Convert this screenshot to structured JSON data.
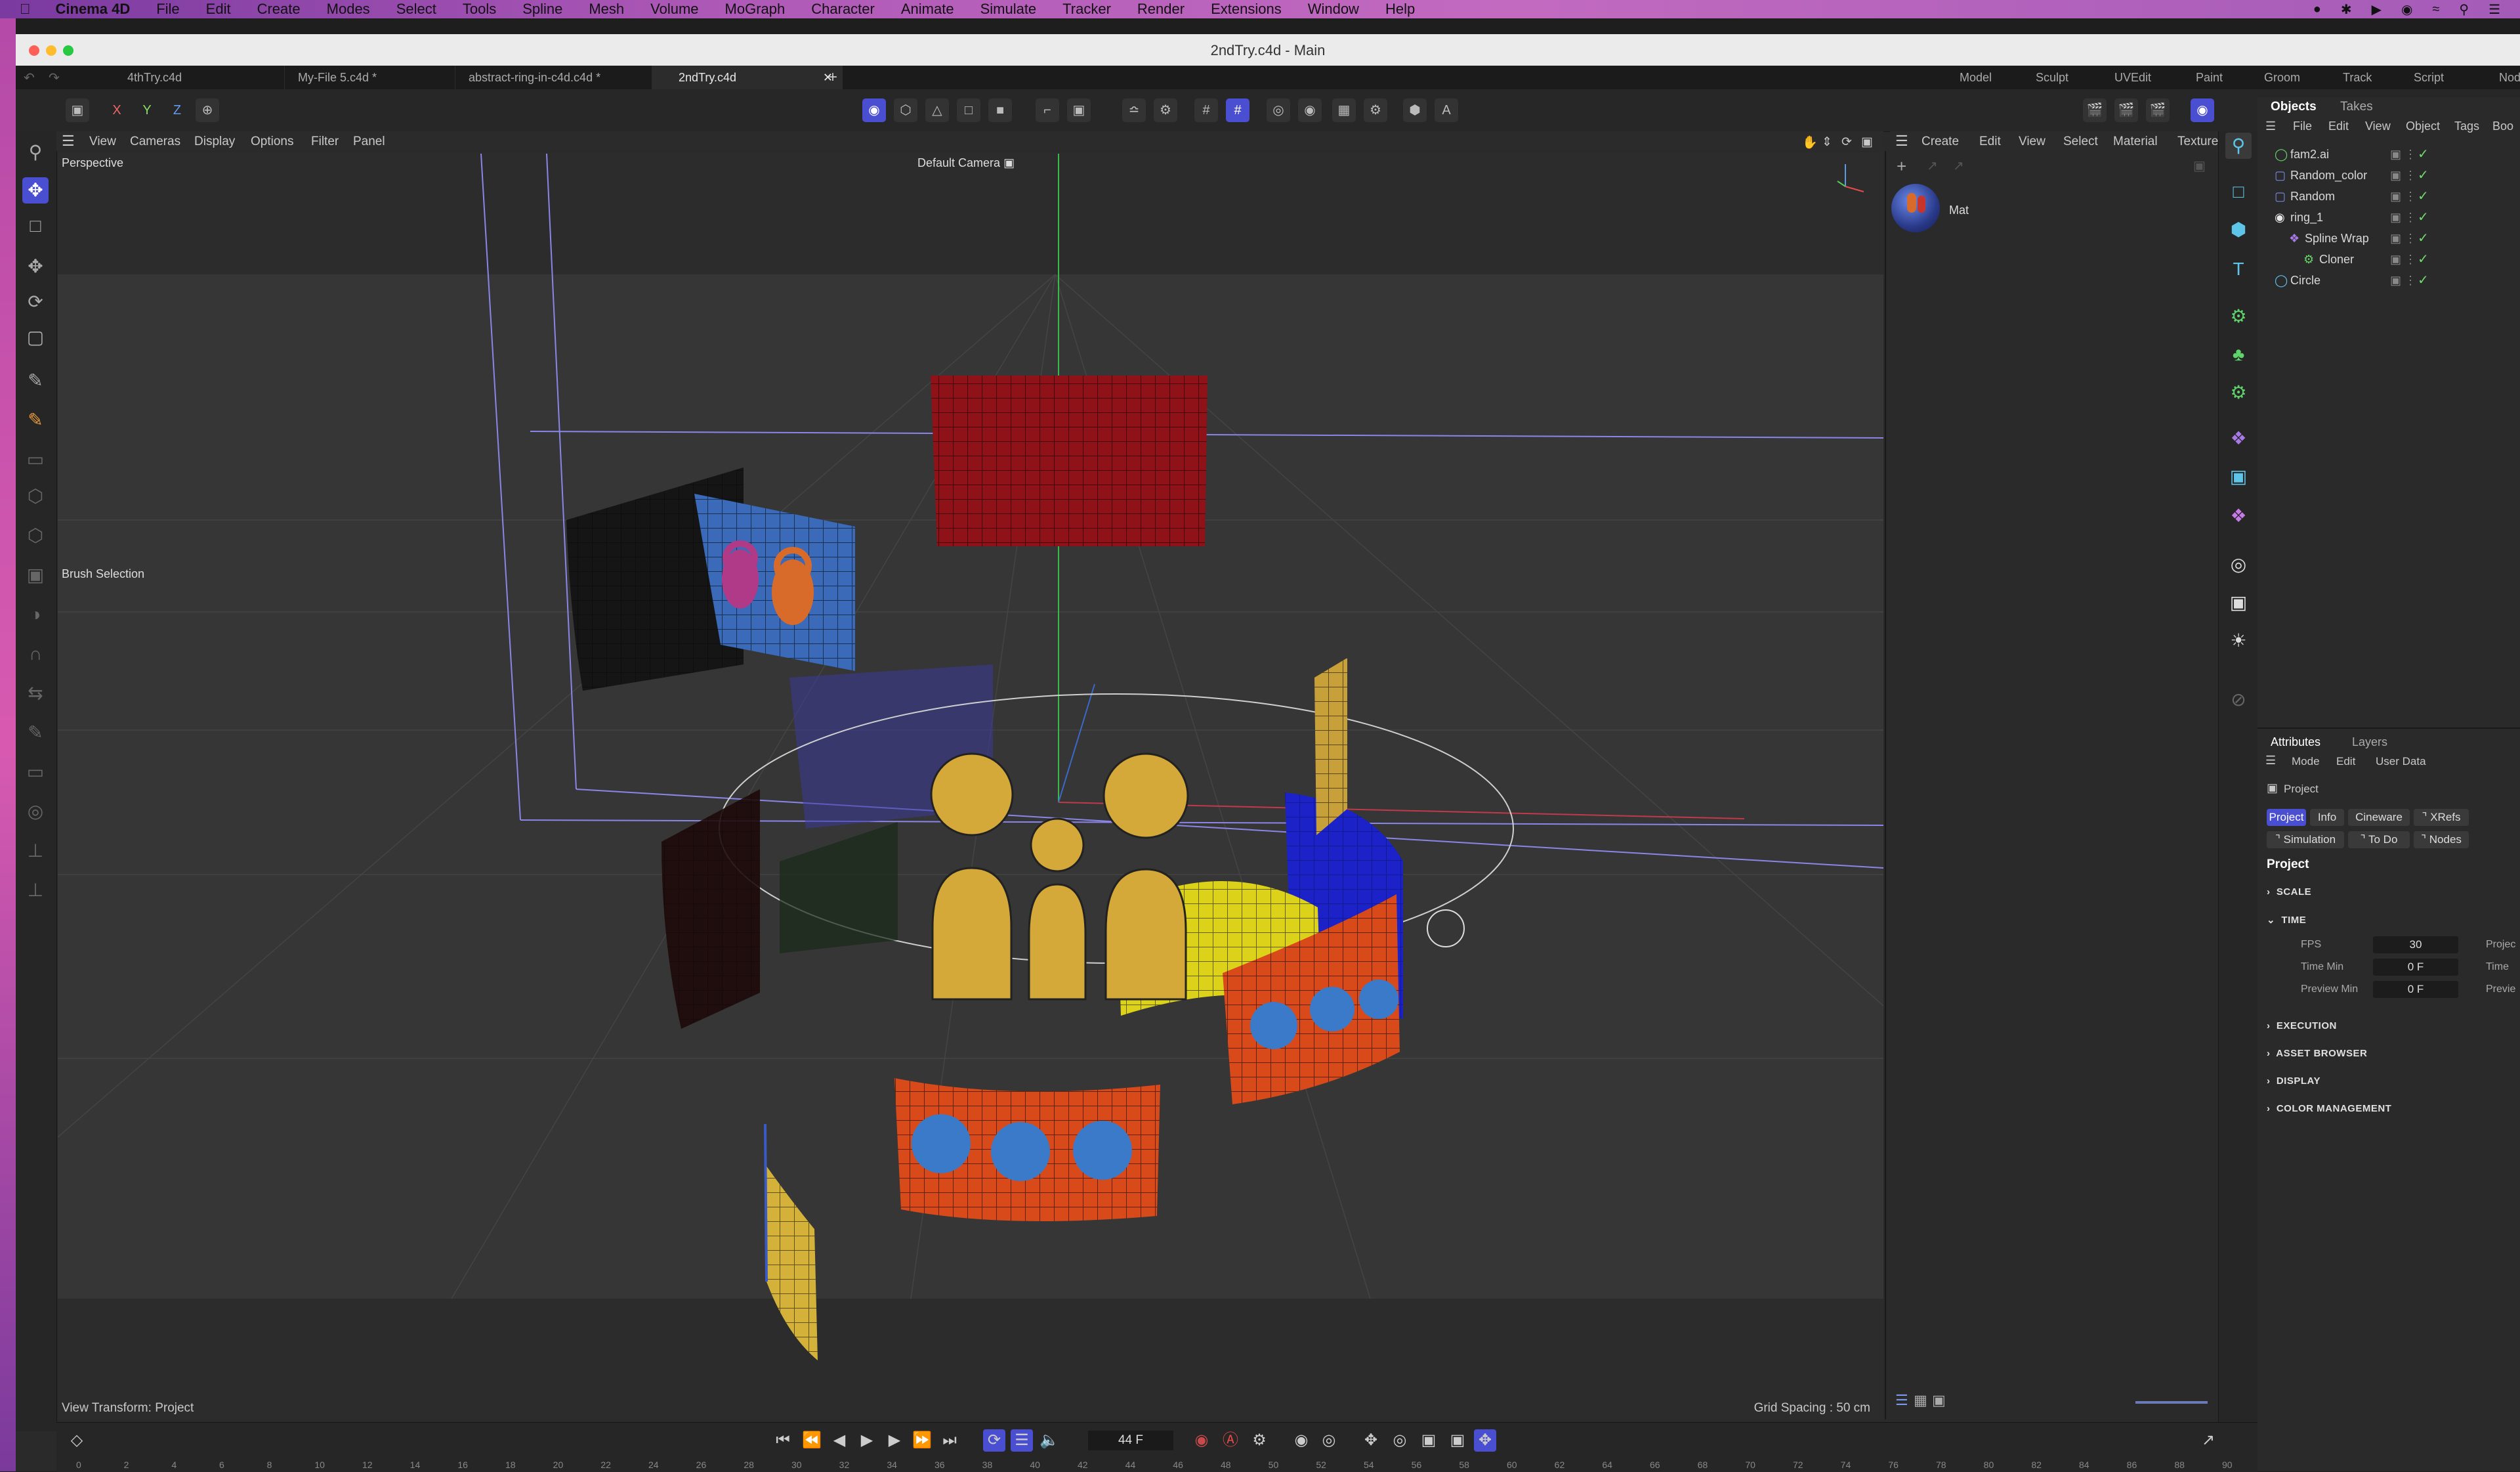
{
  "menubar": {
    "app_name": "Cinema 4D",
    "items": [
      "File",
      "Edit",
      "Create",
      "Modes",
      "Select",
      "Tools",
      "Spline",
      "Mesh",
      "Volume",
      "MoGraph",
      "Character",
      "Animate",
      "Simulate",
      "Tracker",
      "Render",
      "Extensions",
      "Window",
      "Help"
    ]
  },
  "window": {
    "title": "2ndTry.c4d - Main"
  },
  "doc_tabs": [
    {
      "label": "4thTry.c4d"
    },
    {
      "label": "My-File 5.c4d *"
    },
    {
      "label": "abstract-ring-in-c4d.c4d *"
    },
    {
      "label": "2ndTry.c4d"
    }
  ],
  "layouts": [
    "Model",
    "Sculpt",
    "UVEdit",
    "Paint",
    "Groom",
    "Track",
    "Script",
    "Nod"
  ],
  "axis_lock": {
    "x": "X",
    "y": "Y",
    "z": "Z"
  },
  "viewport": {
    "menu": [
      "View",
      "Cameras",
      "Display",
      "Options",
      "Filter",
      "Panel"
    ],
    "label": "Perspective",
    "camera": "Default Camera",
    "tool_hint": "Brush Selection",
    "status_left": "View Transform: Project",
    "status_right": "Grid Spacing : 50 cm"
  },
  "material_manager": {
    "menu": [
      "Create",
      "Edit",
      "View",
      "Select",
      "Material",
      "Texture"
    ],
    "material_name": "Mat"
  },
  "objects_panel": {
    "tabs": [
      "Objects",
      "Takes"
    ],
    "menu": [
      "File",
      "Edit",
      "View",
      "Object",
      "Tags",
      "Boo"
    ],
    "items": [
      {
        "name": "fam2.ai",
        "icon": "spline-icon",
        "indent": 0
      },
      {
        "name": "Random_color",
        "icon": "effector-icon",
        "indent": 0
      },
      {
        "name": "Random",
        "icon": "effector-icon",
        "indent": 0
      },
      {
        "name": "ring_1",
        "icon": "null-icon",
        "indent": 0
      },
      {
        "name": "Spline Wrap",
        "icon": "deformer-icon",
        "indent": 1
      },
      {
        "name": "Cloner",
        "icon": "cloner-icon",
        "indent": 2
      },
      {
        "name": "Circle",
        "icon": "circle-icon",
        "indent": 0
      }
    ]
  },
  "attributes": {
    "tabs": [
      "Attributes",
      "Layers"
    ],
    "menu": [
      "Mode",
      "Edit",
      "User Data"
    ],
    "object": "Project",
    "buttons_row1": [
      "Project",
      "Info",
      "Cineware",
      "XRefs"
    ],
    "buttons_row2": [
      "Simulation",
      "To Do",
      "Nodes"
    ],
    "heading": "Project",
    "sections": [
      "SCALE",
      "TIME",
      "EXECUTION",
      "ASSET BROWSER",
      "DISPLAY",
      "COLOR MANAGEMENT"
    ],
    "time_fields": [
      {
        "label": "FPS",
        "value": "30",
        "right": "Projec"
      },
      {
        "label": "Time Min",
        "value": "0 F",
        "right": "Time"
      },
      {
        "label": "Preview Min",
        "value": "0 F",
        "right": "Previe"
      }
    ]
  },
  "timeline": {
    "current_frame": "44 F",
    "ticks": [
      "0",
      "2",
      "4",
      "6",
      "8",
      "10",
      "12",
      "14",
      "16",
      "18",
      "20",
      "22",
      "24",
      "26",
      "28",
      "30",
      "32",
      "34",
      "36",
      "38",
      "40",
      "42",
      "44",
      "46",
      "48",
      "50",
      "52",
      "54",
      "56",
      "58",
      "60",
      "62",
      "64",
      "66",
      "68",
      "70",
      "72",
      "74",
      "76",
      "78",
      "80",
      "82",
      "84",
      "86",
      "88",
      "90"
    ]
  }
}
